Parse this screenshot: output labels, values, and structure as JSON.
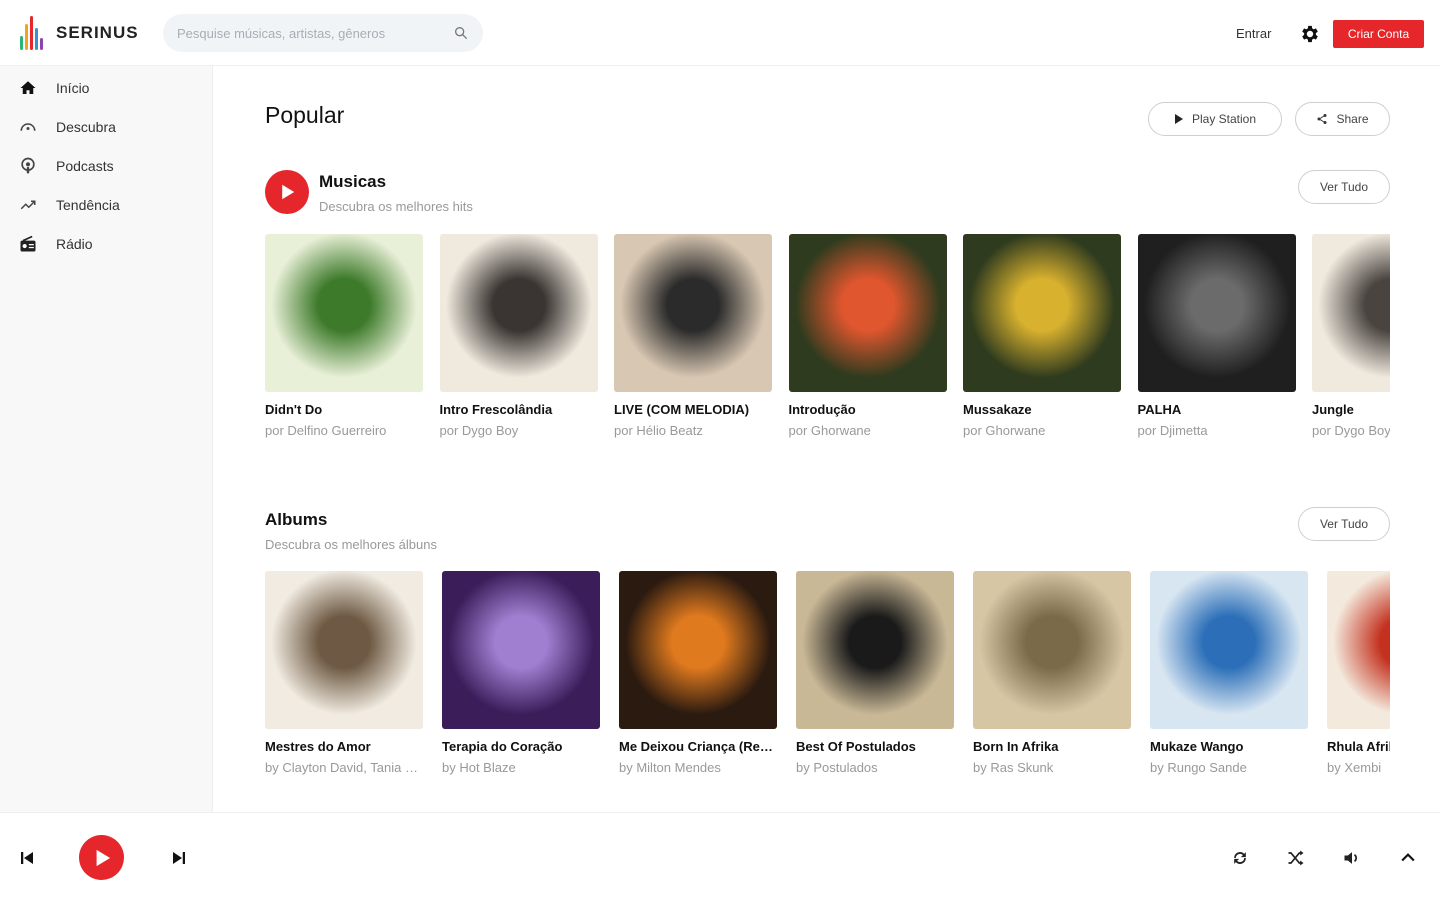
{
  "brand": {
    "name": "SERINUS",
    "accent": "#e5262a"
  },
  "header": {
    "search_placeholder": "Pesquise músicas, artistas, gêneros",
    "signin_label": "Entrar",
    "create_account_label": "Criar Conta"
  },
  "sidebar": {
    "items": [
      {
        "label": "Início",
        "icon": "home-icon"
      },
      {
        "label": "Descubra",
        "icon": "discover-icon"
      },
      {
        "label": "Podcasts",
        "icon": "podcast-icon"
      },
      {
        "label": "Tendência",
        "icon": "trending-icon"
      },
      {
        "label": "Rádio",
        "icon": "radio-icon"
      }
    ]
  },
  "main": {
    "title": "Popular",
    "play_station_label": "Play Station",
    "share_label": "Share",
    "songs": {
      "title": "Musicas",
      "subtitle": "Descubra os melhores hits",
      "see_all_label": "Ver Tudo",
      "items": [
        {
          "title": "Didn't Do",
          "artist": "por Delfino Guerreiro",
          "art": [
            "#e9f0d8",
            "#3d7a2a"
          ]
        },
        {
          "title": "Intro Frescolândia",
          "artist": "por Dygo Boy",
          "art": [
            "#efe9de",
            "#3a3532"
          ]
        },
        {
          "title": "LIVE (COM MELODIA)",
          "artist": "por Hélio Beatz",
          "art": [
            "#d8c7b2",
            "#2b2b2b"
          ]
        },
        {
          "title": "Introdução",
          "artist": "por Ghorwane",
          "art": [
            "#2f3b1e",
            "#e0562e"
          ]
        },
        {
          "title": "Mussakaze",
          "artist": "por Ghorwane",
          "art": [
            "#2f3b1e",
            "#d8b12e"
          ]
        },
        {
          "title": "PALHA",
          "artist": "por Djimetta",
          "art": [
            "#1f1f1f",
            "#6b6b6b"
          ]
        },
        {
          "title": "Jungle",
          "artist": "por Dygo Boy",
          "art": [
            "#efe9de",
            "#4a4440"
          ]
        }
      ]
    },
    "albums": {
      "title": "Albums",
      "subtitle": "Descubra os melhores álbuns",
      "see_all_label": "Ver Tudo",
      "items": [
        {
          "title": "Mestres do Amor",
          "artist": "by Clayton David, Tania Mestres",
          "art": [
            "#f1ebe1",
            "#6e5a44"
          ]
        },
        {
          "title": "Terapia do Coração",
          "artist": "by Hot Blaze",
          "art": [
            "#3b1d5a",
            "#a07fd1"
          ]
        },
        {
          "title": "Me Deixou Criança (Remix)",
          "artist": "by Milton Mendes",
          "art": [
            "#2a1a10",
            "#e07a1e"
          ]
        },
        {
          "title": "Best Of Postulados",
          "artist": "by Postulados",
          "art": [
            "#c9b896",
            "#1a1a1a"
          ]
        },
        {
          "title": "Born In Afrika",
          "artist": "by Ras Skunk",
          "art": [
            "#d6c6a4",
            "#7a6a4a"
          ]
        },
        {
          "title": "Mukaze Wango",
          "artist": "by Rungo Sande",
          "art": [
            "#d8e6f2",
            "#2c6fb8"
          ]
        },
        {
          "title": "Rhula Afrika",
          "artist": "by Xembi",
          "art": [
            "#f3e9dc",
            "#c4311f"
          ]
        }
      ]
    }
  },
  "player": {
    "icons": [
      "previous-icon",
      "play-icon",
      "next-icon",
      "repeat-icon",
      "shuffle-icon",
      "volume-icon",
      "expand-up-icon"
    ]
  }
}
